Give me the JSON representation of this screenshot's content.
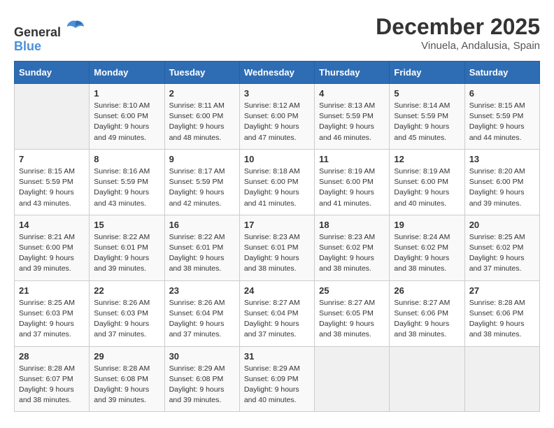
{
  "logo": {
    "text_general": "General",
    "text_blue": "Blue"
  },
  "title": "December 2025",
  "subtitle": "Vinuela, Andalusia, Spain",
  "days_of_week": [
    "Sunday",
    "Monday",
    "Tuesday",
    "Wednesday",
    "Thursday",
    "Friday",
    "Saturday"
  ],
  "weeks": [
    [
      {
        "day": "",
        "info": ""
      },
      {
        "day": "1",
        "info": "Sunrise: 8:10 AM\nSunset: 6:00 PM\nDaylight: 9 hours\nand 49 minutes."
      },
      {
        "day": "2",
        "info": "Sunrise: 8:11 AM\nSunset: 6:00 PM\nDaylight: 9 hours\nand 48 minutes."
      },
      {
        "day": "3",
        "info": "Sunrise: 8:12 AM\nSunset: 6:00 PM\nDaylight: 9 hours\nand 47 minutes."
      },
      {
        "day": "4",
        "info": "Sunrise: 8:13 AM\nSunset: 5:59 PM\nDaylight: 9 hours\nand 46 minutes."
      },
      {
        "day": "5",
        "info": "Sunrise: 8:14 AM\nSunset: 5:59 PM\nDaylight: 9 hours\nand 45 minutes."
      },
      {
        "day": "6",
        "info": "Sunrise: 8:15 AM\nSunset: 5:59 PM\nDaylight: 9 hours\nand 44 minutes."
      }
    ],
    [
      {
        "day": "7",
        "info": "Sunrise: 8:15 AM\nSunset: 5:59 PM\nDaylight: 9 hours\nand 43 minutes."
      },
      {
        "day": "8",
        "info": "Sunrise: 8:16 AM\nSunset: 5:59 PM\nDaylight: 9 hours\nand 43 minutes."
      },
      {
        "day": "9",
        "info": "Sunrise: 8:17 AM\nSunset: 5:59 PM\nDaylight: 9 hours\nand 42 minutes."
      },
      {
        "day": "10",
        "info": "Sunrise: 8:18 AM\nSunset: 6:00 PM\nDaylight: 9 hours\nand 41 minutes."
      },
      {
        "day": "11",
        "info": "Sunrise: 8:19 AM\nSunset: 6:00 PM\nDaylight: 9 hours\nand 41 minutes."
      },
      {
        "day": "12",
        "info": "Sunrise: 8:19 AM\nSunset: 6:00 PM\nDaylight: 9 hours\nand 40 minutes."
      },
      {
        "day": "13",
        "info": "Sunrise: 8:20 AM\nSunset: 6:00 PM\nDaylight: 9 hours\nand 39 minutes."
      }
    ],
    [
      {
        "day": "14",
        "info": "Sunrise: 8:21 AM\nSunset: 6:00 PM\nDaylight: 9 hours\nand 39 minutes."
      },
      {
        "day": "15",
        "info": "Sunrise: 8:22 AM\nSunset: 6:01 PM\nDaylight: 9 hours\nand 39 minutes."
      },
      {
        "day": "16",
        "info": "Sunrise: 8:22 AM\nSunset: 6:01 PM\nDaylight: 9 hours\nand 38 minutes."
      },
      {
        "day": "17",
        "info": "Sunrise: 8:23 AM\nSunset: 6:01 PM\nDaylight: 9 hours\nand 38 minutes."
      },
      {
        "day": "18",
        "info": "Sunrise: 8:23 AM\nSunset: 6:02 PM\nDaylight: 9 hours\nand 38 minutes."
      },
      {
        "day": "19",
        "info": "Sunrise: 8:24 AM\nSunset: 6:02 PM\nDaylight: 9 hours\nand 38 minutes."
      },
      {
        "day": "20",
        "info": "Sunrise: 8:25 AM\nSunset: 6:02 PM\nDaylight: 9 hours\nand 37 minutes."
      }
    ],
    [
      {
        "day": "21",
        "info": "Sunrise: 8:25 AM\nSunset: 6:03 PM\nDaylight: 9 hours\nand 37 minutes."
      },
      {
        "day": "22",
        "info": "Sunrise: 8:26 AM\nSunset: 6:03 PM\nDaylight: 9 hours\nand 37 minutes."
      },
      {
        "day": "23",
        "info": "Sunrise: 8:26 AM\nSunset: 6:04 PM\nDaylight: 9 hours\nand 37 minutes."
      },
      {
        "day": "24",
        "info": "Sunrise: 8:27 AM\nSunset: 6:04 PM\nDaylight: 9 hours\nand 37 minutes."
      },
      {
        "day": "25",
        "info": "Sunrise: 8:27 AM\nSunset: 6:05 PM\nDaylight: 9 hours\nand 38 minutes."
      },
      {
        "day": "26",
        "info": "Sunrise: 8:27 AM\nSunset: 6:06 PM\nDaylight: 9 hours\nand 38 minutes."
      },
      {
        "day": "27",
        "info": "Sunrise: 8:28 AM\nSunset: 6:06 PM\nDaylight: 9 hours\nand 38 minutes."
      }
    ],
    [
      {
        "day": "28",
        "info": "Sunrise: 8:28 AM\nSunset: 6:07 PM\nDaylight: 9 hours\nand 38 minutes."
      },
      {
        "day": "29",
        "info": "Sunrise: 8:28 AM\nSunset: 6:08 PM\nDaylight: 9 hours\nand 39 minutes."
      },
      {
        "day": "30",
        "info": "Sunrise: 8:29 AM\nSunset: 6:08 PM\nDaylight: 9 hours\nand 39 minutes."
      },
      {
        "day": "31",
        "info": "Sunrise: 8:29 AM\nSunset: 6:09 PM\nDaylight: 9 hours\nand 40 minutes."
      },
      {
        "day": "",
        "info": ""
      },
      {
        "day": "",
        "info": ""
      },
      {
        "day": "",
        "info": ""
      }
    ]
  ]
}
